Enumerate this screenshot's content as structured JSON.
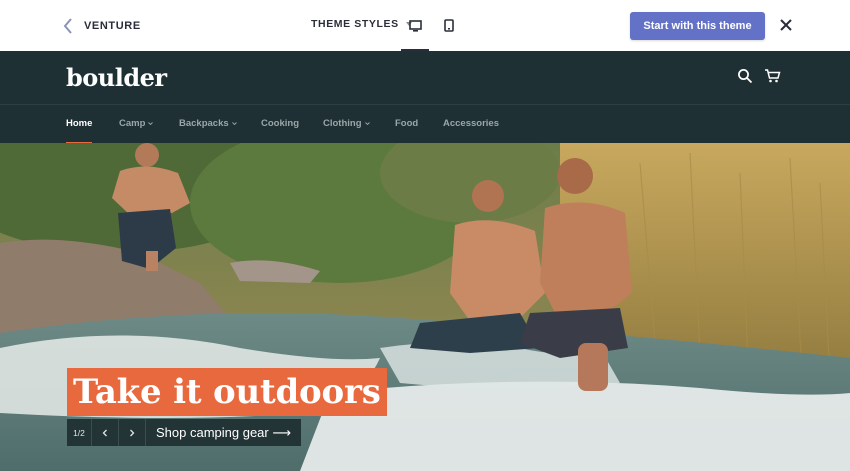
{
  "preview_bar": {
    "back_label": "VENTURE",
    "theme_styles_label": "THEME STYLES",
    "cta_label": "Start with this theme",
    "cta_color": "#6371c7",
    "icons": [
      "chevron-left-icon",
      "chevron-down-icon",
      "desktop-icon",
      "mobile-icon",
      "close-icon"
    ]
  },
  "store": {
    "logo": "boulder",
    "header_color": "#1f3034",
    "accent_color": "#e8693d",
    "icons": [
      "search-icon",
      "cart-icon"
    ],
    "nav": [
      {
        "label": "Home",
        "active": true,
        "dropdown": false
      },
      {
        "label": "Camp",
        "active": false,
        "dropdown": true
      },
      {
        "label": "Backpacks",
        "active": false,
        "dropdown": true
      },
      {
        "label": "Cooking",
        "active": false,
        "dropdown": false
      },
      {
        "label": "Clothing",
        "active": false,
        "dropdown": true
      },
      {
        "label": "Food",
        "active": false,
        "dropdown": false
      },
      {
        "label": "Accessories",
        "active": false,
        "dropdown": false
      }
    ]
  },
  "hero": {
    "headline": "Take it outdoors",
    "slide_counter": "1/2",
    "cta_label": "Shop camping gear ⟶",
    "image_description_icon": "hero-photo"
  }
}
